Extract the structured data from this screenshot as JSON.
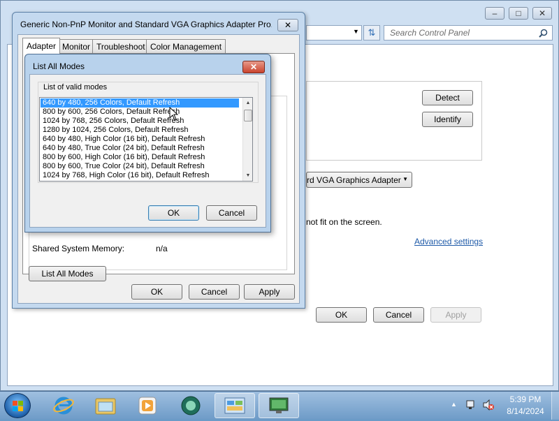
{
  "control_panel": {
    "search_placeholder": "Search Control Panel",
    "detect_label": "Detect",
    "identify_label": "Identify",
    "adapter_select_value": "rd VGA Graphics Adapter",
    "fit_text": "not fit on the screen.",
    "advanced_link": "Advanced settings",
    "ok_label": "OK",
    "cancel_label": "Cancel",
    "apply_label": "Apply"
  },
  "properties_dialog": {
    "title": "Generic Non-PnP Monitor and Standard VGA Graphics Adapter Pro...",
    "tabs": [
      "Adapter",
      "Monitor",
      "Troubleshoot",
      "Color Management"
    ],
    "shared_memory_label": "Shared System Memory:",
    "shared_memory_value": "n/a",
    "list_all_modes_label": "List All Modes",
    "ok_label": "OK",
    "cancel_label": "Cancel",
    "apply_label": "Apply"
  },
  "modes_dialog": {
    "title": "List All Modes",
    "group_label": "List of valid modes",
    "modes": [
      "640 by 480, 256 Colors, Default Refresh",
      "800 by 600, 256 Colors, Default Refresh",
      "1024 by 768, 256 Colors, Default Refresh",
      "1280 by 1024, 256 Colors, Default Refresh",
      "640 by 480, High Color (16 bit), Default Refresh",
      "640 by 480, True Color (24 bit), Default Refresh",
      "800 by 600, High Color (16 bit), Default Refresh",
      "800 by 600, True Color (24 bit), Default Refresh",
      "1024 by 768, High Color (16 bit), Default Refresh"
    ],
    "selected_index": 0,
    "ok_label": "OK",
    "cancel_label": "Cancel"
  },
  "taskbar": {
    "time": "5:39 PM",
    "date": "8/14/2024"
  },
  "colors": {
    "selection": "#3399ff",
    "link": "#1e5aa8"
  }
}
